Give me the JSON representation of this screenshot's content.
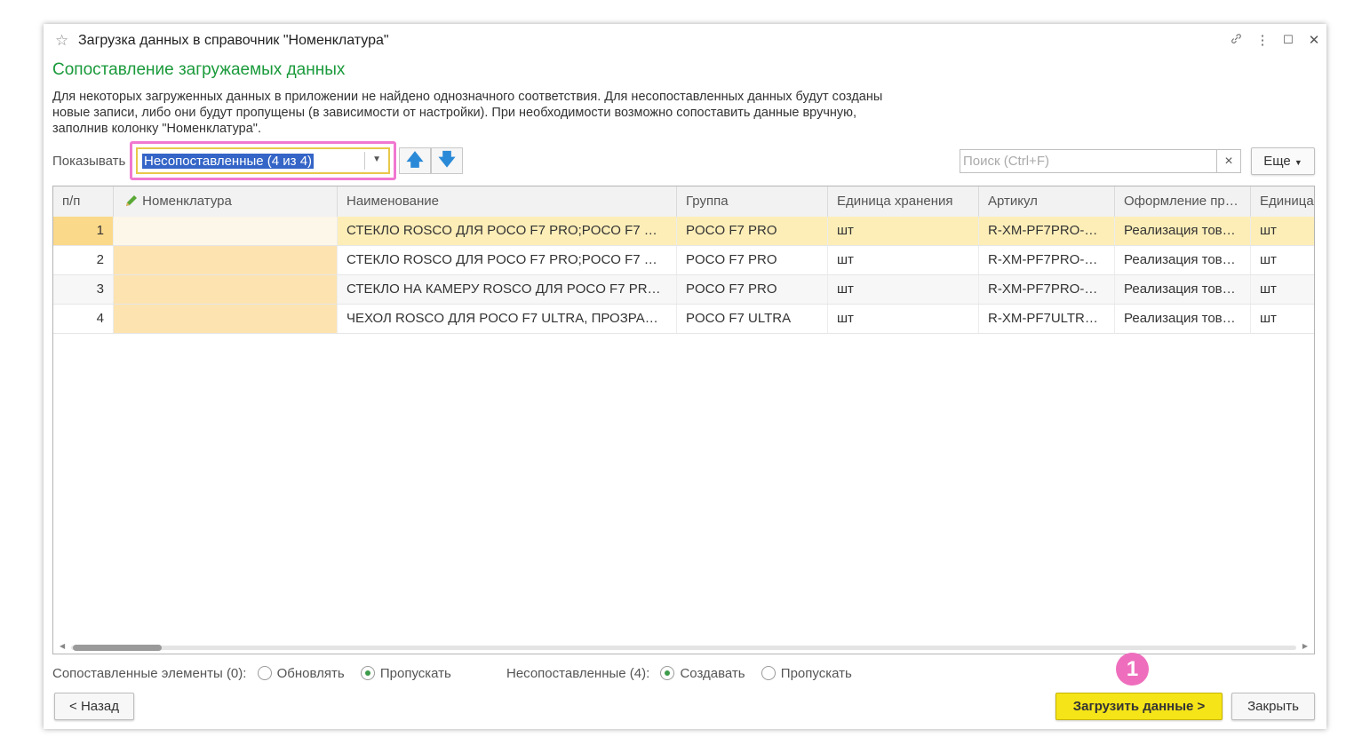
{
  "window": {
    "title": "Загрузка данных в справочник \"Номенклатура\""
  },
  "subtitle": "Сопоставление загружаемых данных",
  "description": [
    "Для некоторых загруженных данных в приложении не найдено однозначного соответствия.  Для несопоставленных данных будут созданы",
    "новые записи, либо они будут пропущены (в зависимости от настройки). При необходимости возможно сопоставить данные вручную,",
    "заполнив колонку \"Номенклатура\"."
  ],
  "filter": {
    "label": "Показывать",
    "value": "Несопоставленные (4 из 4)"
  },
  "search": {
    "placeholder": "Поиск (Ctrl+F)"
  },
  "more_label": "Еще",
  "table": {
    "columns": [
      "п/п",
      "Номенклатура",
      "Наименование",
      "Группа",
      "Единица хранения",
      "Артикул",
      "Оформление пр…",
      "Единица"
    ],
    "rows": [
      [
        "1",
        "",
        "СТЕКЛО ROSCO ДЛЯ POCO F7 PRO;POCO F7 …",
        "POCO F7 PRO",
        "шт",
        "R-XM-PF7PRO-…",
        "Реализация тов…",
        "шт"
      ],
      [
        "2",
        "",
        "СТЕКЛО ROSCO ДЛЯ POCO F7 PRO;POCO F7 …",
        "POCO F7 PRO",
        "шт",
        "R-XM-PF7PRO-…",
        "Реализация тов…",
        "шт"
      ],
      [
        "3",
        "",
        "СТЕКЛО НА КАМЕРУ ROSCO ДЛЯ POCO F7 PR…",
        "POCO F7 PRO",
        "шт",
        "R-XM-PF7PRO-…",
        "Реализация тов…",
        "шт"
      ],
      [
        "4",
        "",
        "ЧЕХОЛ ROSCO ДЛЯ POCO F7 ULTRA, ПРОЗРА…",
        "POCO F7 ULTRA",
        "шт",
        "R-XM-PF7ULTR…",
        "Реализация тов…",
        "шт"
      ]
    ]
  },
  "matched": {
    "label": "Сопоставленные элементы (0):",
    "opt1": "Обновлять",
    "opt2": "Пропускать"
  },
  "unmatched": {
    "label": "Несопоставленные (4):",
    "opt1": "Создавать",
    "opt2": "Пропускать"
  },
  "buttons": {
    "back": "< Назад",
    "load": "Загрузить данные >",
    "close": "Закрыть"
  },
  "badge": "1",
  "icons": {
    "favorite": "star-icon",
    "link": "link-icon",
    "menu": "more-vertical-icon",
    "maximize": "maximize-icon",
    "close": "close-icon",
    "edit": "pencil-icon",
    "up": "arrow-up-icon",
    "down": "arrow-down-icon"
  },
  "colors": {
    "accent_green": "#1a9a3b",
    "highlight_pink": "#f078d0",
    "primary_yellow": "#f5e418",
    "row_selected": "#fdeeb8",
    "cell_orange": "#fde3b0"
  }
}
